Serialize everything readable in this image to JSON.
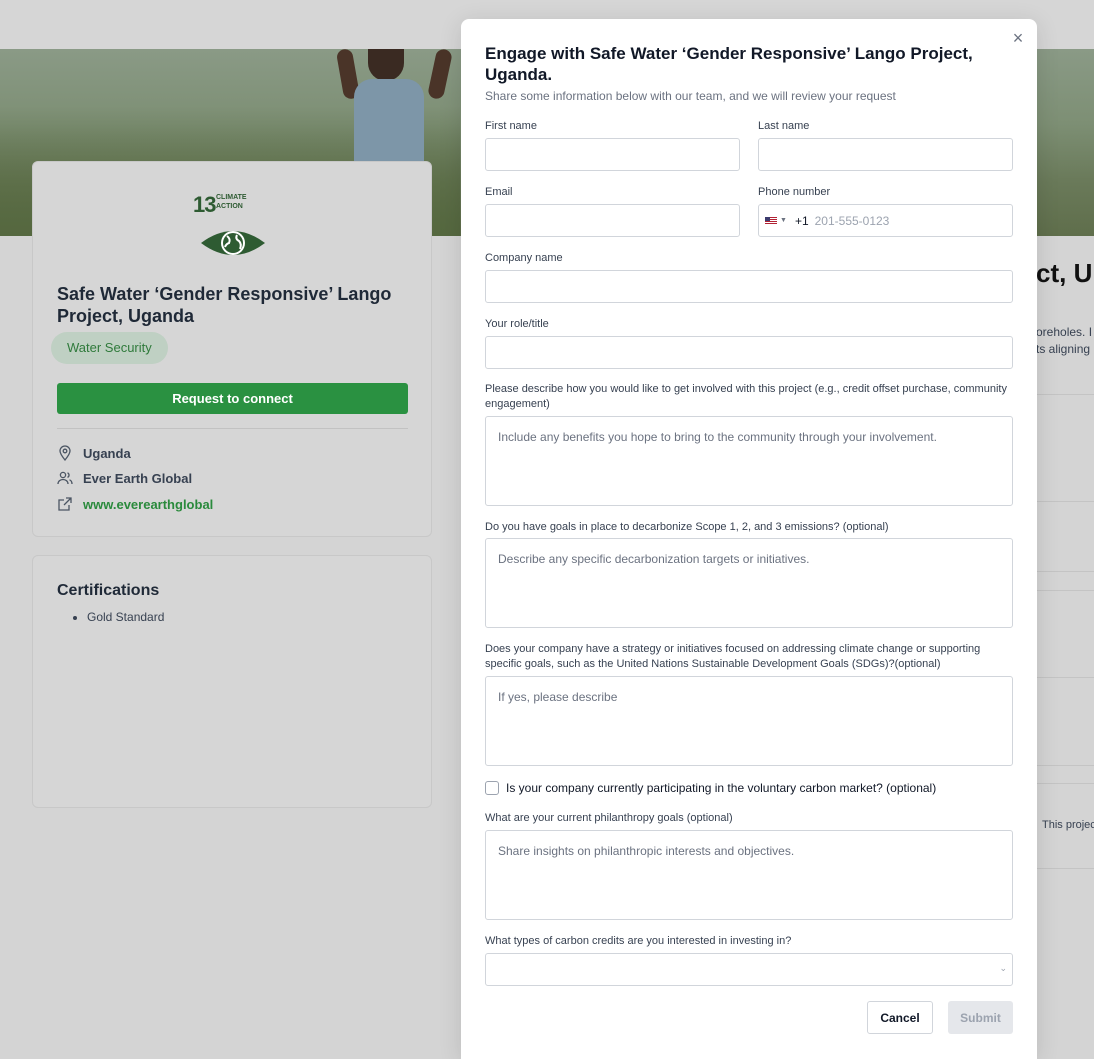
{
  "background": {
    "project_title": "Safe Water ‘Gender Responsive’ Lango Project, Uganda",
    "sdg": {
      "number": "13",
      "label_line1": "CLIMATE",
      "label_line2": "ACTION",
      "icon": "eye-globe-icon"
    },
    "tag": "Water Security",
    "request_button": "Request to connect",
    "location": "Uganda",
    "developer": "Ever Earth Global",
    "website": "www.everearthglobal",
    "certifications_title": "Certifications",
    "certifications": [
      "Gold Standard"
    ],
    "right_title_fragment": "ct, U",
    "right_text_line1": "oreholes. I",
    "right_text_line2": "ts aligning",
    "right_text_line3": "This projec",
    "accent_color": "#2a9141"
  },
  "modal": {
    "title": "Engage with Safe Water ‘Gender Responsive’ Lango Project, Uganda.",
    "subtitle": "Share some information below with our team, and we will review your request",
    "close_icon": "close-icon",
    "first_name": {
      "label": "First name",
      "value": "",
      "placeholder": ""
    },
    "last_name": {
      "label": "Last name",
      "value": "",
      "placeholder": ""
    },
    "email": {
      "label": "Email",
      "value": "",
      "placeholder": ""
    },
    "phone": {
      "label": "Phone number",
      "country_code": "+1",
      "placeholder": "201-555-0123",
      "flag": "us-flag-icon"
    },
    "company": {
      "label": "Company name",
      "value": ""
    },
    "role": {
      "label": "Your role/title",
      "value": ""
    },
    "involvement": {
      "label": "Please describe how you would like to get involved with this project (e.g., credit offset purchase, community engagement)",
      "placeholder": "Include any benefits you hope to bring to the community through your involvement."
    },
    "decarbonize": {
      "label": "Do you have goals in place to decarbonize Scope 1, 2, and 3 emissions? (optional)",
      "placeholder": "Describe any specific decarbonization targets or initiatives."
    },
    "strategy": {
      "label": "Does your company have a strategy or initiatives focused on addressing climate change or supporting specific goals, such as the United Nations Sustainable Development Goals (SDGs)?(optional)",
      "placeholder": "If yes, please describe"
    },
    "voluntary_market": {
      "label": "Is your company currently participating in the voluntary carbon market?  (optional)",
      "checked": false
    },
    "philanthropy": {
      "label": "What are your current philanthropy goals (optional)",
      "placeholder": "Share insights on philanthropic interests and objectives."
    },
    "credit_types": {
      "label": "What types of carbon credits are you interested in investing in?",
      "selected": ""
    },
    "cancel_label": "Cancel",
    "submit_label": "Submit"
  }
}
